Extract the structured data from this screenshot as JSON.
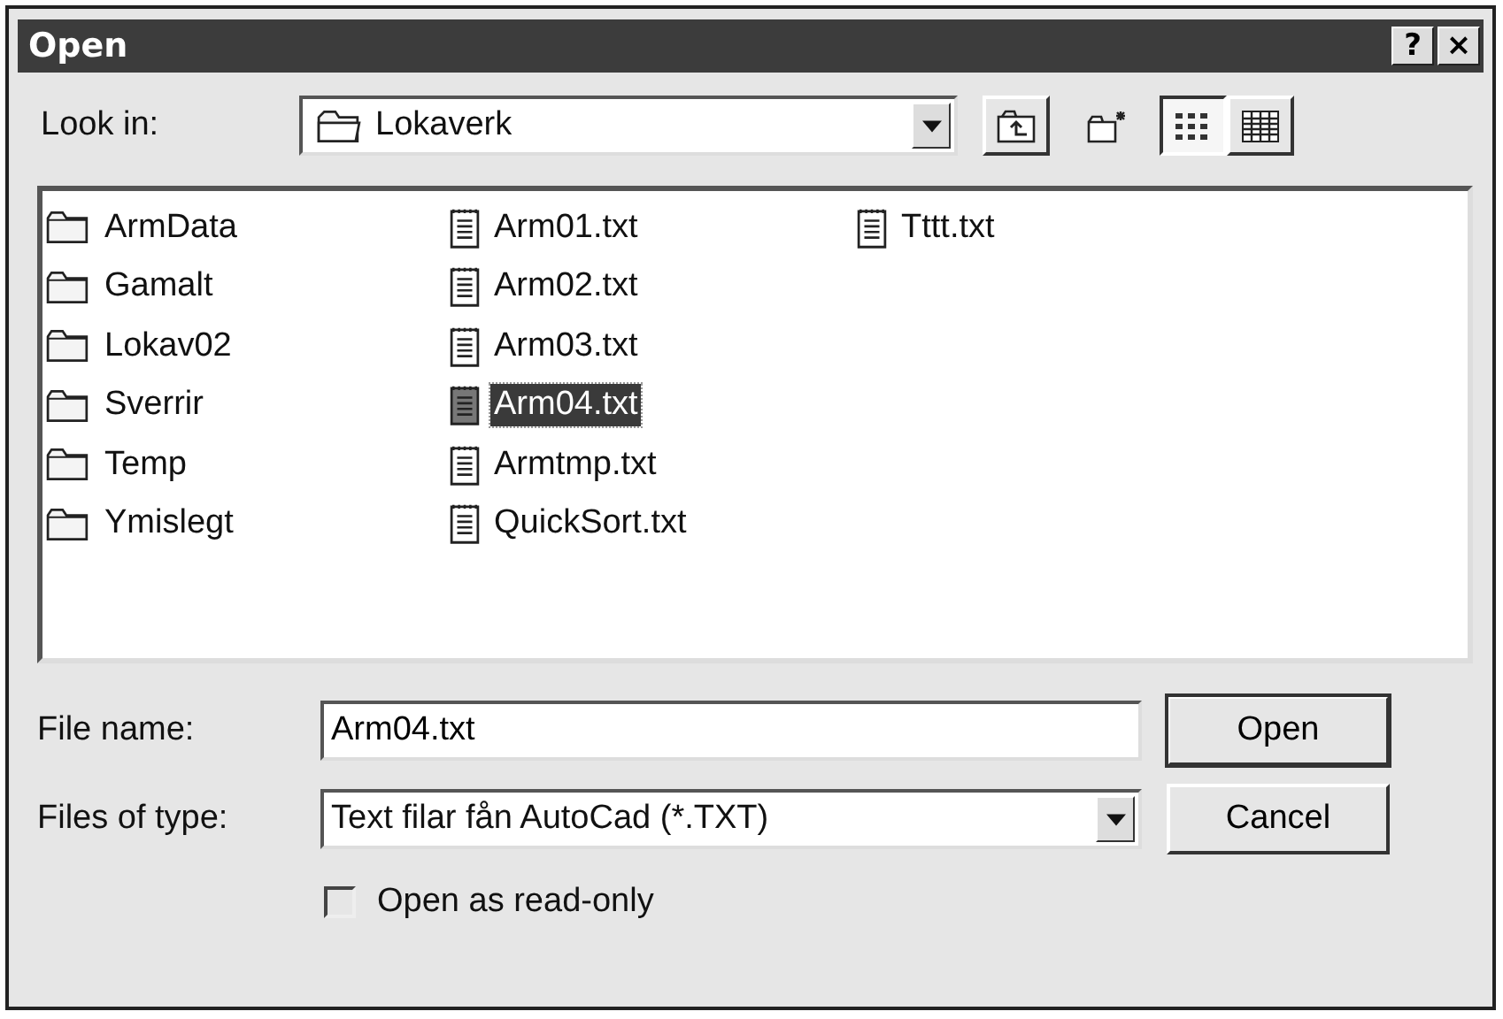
{
  "window": {
    "title": "Open",
    "title_buttons": [
      "?",
      "×"
    ]
  },
  "look_in": {
    "label": "Look in:",
    "value": "Lokaverk"
  },
  "files": [
    {
      "name": "ArmData",
      "kind": "folder",
      "selected": false
    },
    {
      "name": "Gamalt",
      "kind": "folder",
      "selected": false
    },
    {
      "name": "Lokav02",
      "kind": "folder",
      "selected": false
    },
    {
      "name": "Sverrir",
      "kind": "folder",
      "selected": false
    },
    {
      "name": "Temp",
      "kind": "folder",
      "selected": false
    },
    {
      "name": "Ymislegt",
      "kind": "folder",
      "selected": false
    },
    {
      "name": "Arm01.txt",
      "kind": "file",
      "selected": false
    },
    {
      "name": "Arm02.txt",
      "kind": "file",
      "selected": false
    },
    {
      "name": "Arm03.txt",
      "kind": "file",
      "selected": false
    },
    {
      "name": "Arm04.txt",
      "kind": "file",
      "selected": true
    },
    {
      "name": "Armtmp.txt",
      "kind": "file",
      "selected": false
    },
    {
      "name": "QuickSort.txt",
      "kind": "file",
      "selected": false
    },
    {
      "name": "Tttt.txt",
      "kind": "file",
      "selected": false
    }
  ],
  "file_name": {
    "label": "File name:",
    "value": "Arm04.txt"
  },
  "file_type": {
    "label": "Files of type:",
    "value": "Text filar fån AutoCad (*.TXT)"
  },
  "read_only": {
    "label": "Open as read-only",
    "checked": false
  },
  "buttons": [
    "Open",
    "Cancel"
  ]
}
